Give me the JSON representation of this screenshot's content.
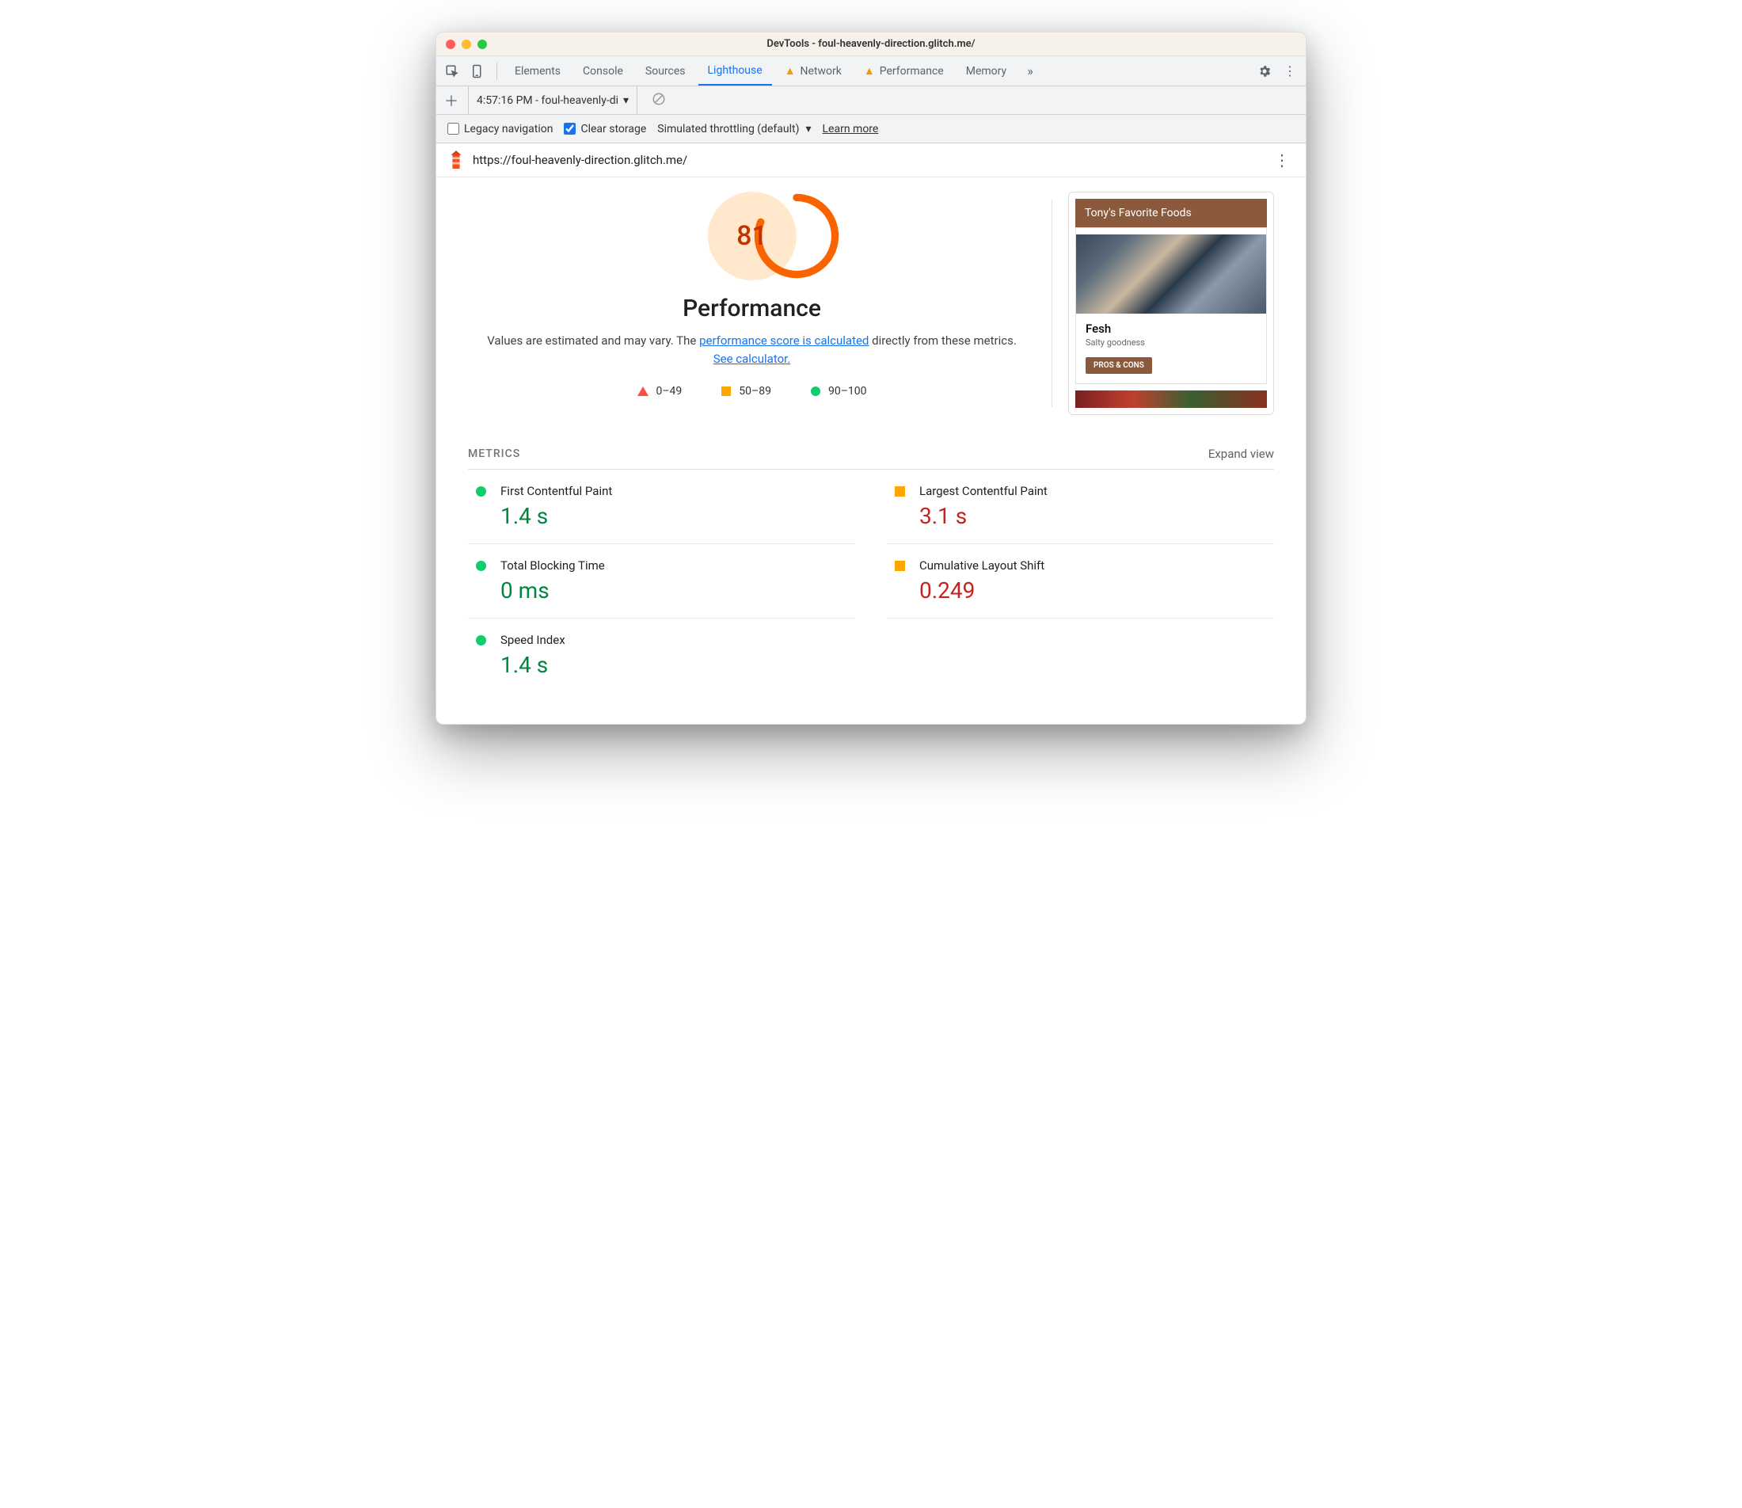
{
  "window": {
    "title": "DevTools - foul-heavenly-direction.glitch.me/"
  },
  "tabs": {
    "elements": "Elements",
    "console": "Console",
    "sources": "Sources",
    "lighthouse": "Lighthouse",
    "network": "Network",
    "performance": "Performance",
    "memory": "Memory"
  },
  "run_selector": {
    "label": "4:57:16 PM - foul-heavenly-di"
  },
  "options": {
    "legacy": "Legacy navigation",
    "clear": "Clear storage",
    "throttle": "Simulated throttling (default)",
    "learn": "Learn more"
  },
  "url": "https://foul-heavenly-direction.glitch.me/",
  "gauge": {
    "score": "81",
    "title": "Performance"
  },
  "desc": {
    "t1": "Values are estimated and may vary. The ",
    "link1": "performance score is calculated",
    "t2": " directly from these metrics. ",
    "link2": "See calculator."
  },
  "legend": {
    "r1": "0–49",
    "r2": "50–89",
    "r3": "90–100"
  },
  "preview": {
    "header": "Tony's Favorite Foods",
    "card_title": "Fesh",
    "card_sub": "Salty goodness",
    "pros": "PROS & CONS"
  },
  "metrics": {
    "heading": "METRICS",
    "expand": "Expand view",
    "items": [
      {
        "name": "First Contentful Paint",
        "value": "1.4 s",
        "status": "good"
      },
      {
        "name": "Largest Contentful Paint",
        "value": "3.1 s",
        "status": "avg"
      },
      {
        "name": "Total Blocking Time",
        "value": "0 ms",
        "status": "good"
      },
      {
        "name": "Cumulative Layout Shift",
        "value": "0.249",
        "status": "avg"
      },
      {
        "name": "Speed Index",
        "value": "1.4 s",
        "status": "good"
      }
    ]
  }
}
